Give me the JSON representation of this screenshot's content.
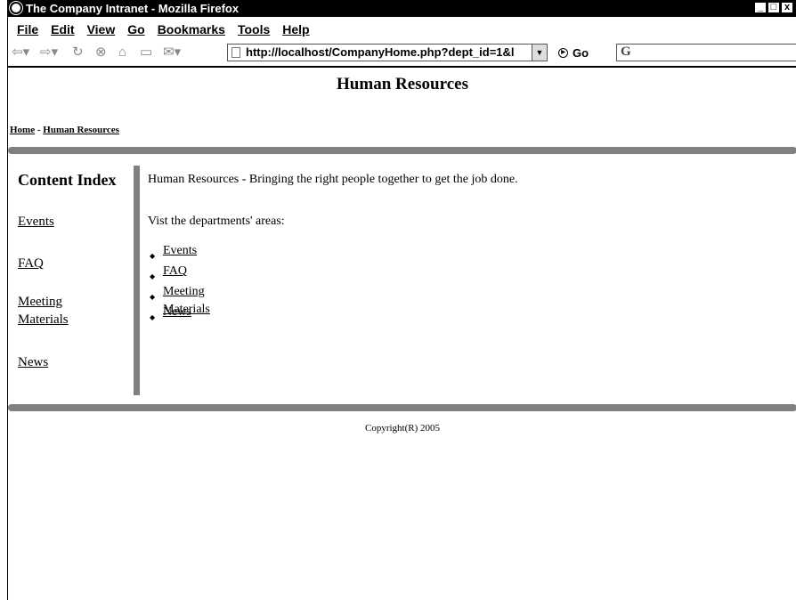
{
  "window": {
    "title": "The Company Intranet - Mozilla Firefox",
    "buttons": [
      "_",
      "□",
      "x"
    ]
  },
  "menubar": {
    "items": [
      {
        "label": "File"
      },
      {
        "label": "Edit"
      },
      {
        "label": "View"
      },
      {
        "label": "Go"
      },
      {
        "label": "Bookmarks"
      },
      {
        "label": "Tools"
      },
      {
        "label": "Help"
      }
    ]
  },
  "toolbar": {
    "url": "http://localhost/CompanyHome.php?dept_id=1&l",
    "go_label": "Go",
    "search_value": "G"
  },
  "page": {
    "title": "Human Resources",
    "breadcrumb": {
      "home": "Home",
      "sep": " - ",
      "current": "Human Resources"
    },
    "sidebar": {
      "heading": "Content Index",
      "links": [
        "Events",
        "FAQ",
        "Meeting Materials",
        "News"
      ]
    },
    "content": {
      "intro": "Human Resources - Bringing the right people together to get the job done.",
      "visit": "Vist the departments' areas:",
      "links": [
        "Events",
        "FAQ",
        "Meeting Materials",
        "News"
      ]
    },
    "footer": "Copyright(R) 2005"
  }
}
